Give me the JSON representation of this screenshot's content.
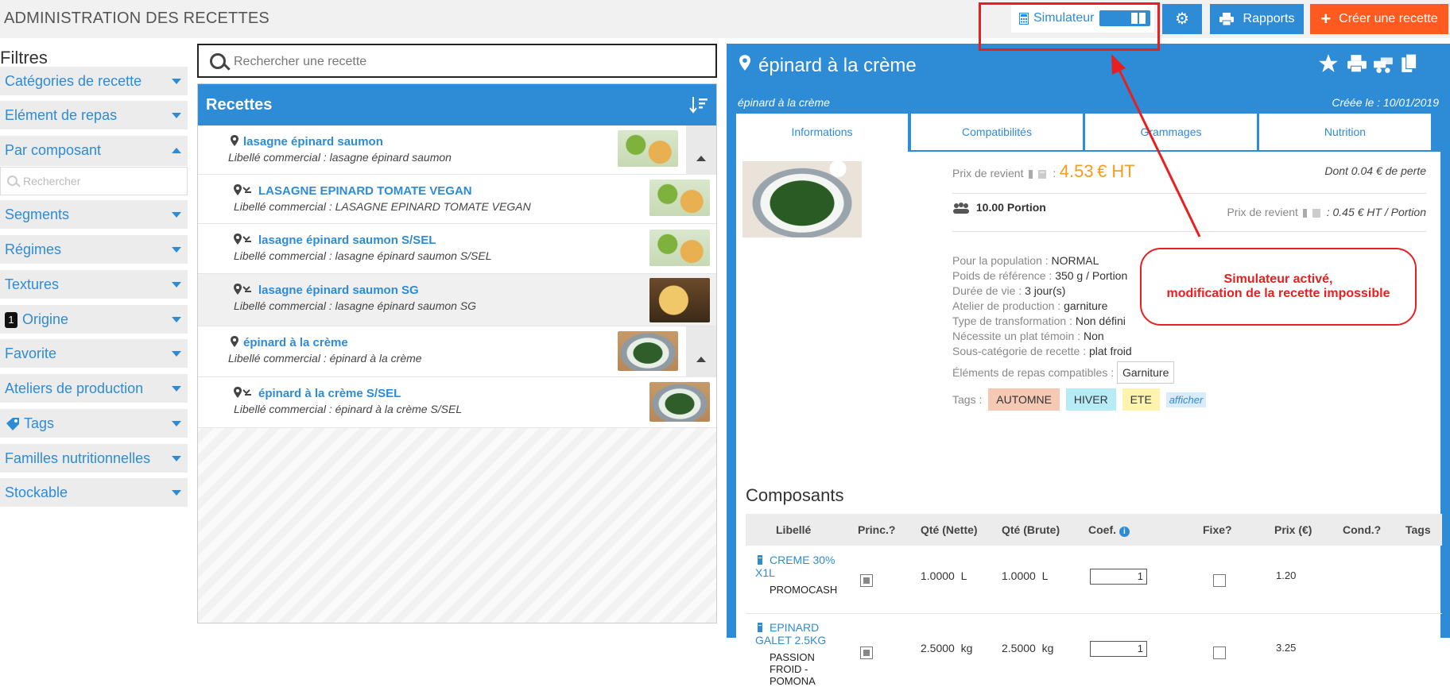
{
  "header": {
    "title": "ADMINISTRATION DES RECETTES",
    "simulator_label": "Simulateur",
    "reports_label": "Rapports",
    "create_label": "Créer une recette"
  },
  "filters": {
    "title": "Filtres",
    "search_placeholder": "Rechercher",
    "origin_badge": "1",
    "items": [
      {
        "label": "Catégories de recette"
      },
      {
        "label": "Elément de repas"
      },
      {
        "label": "Par composant"
      },
      {
        "label": "Segments"
      },
      {
        "label": "Régimes"
      },
      {
        "label": "Textures"
      },
      {
        "label": "Origine"
      },
      {
        "label": "Favorite"
      },
      {
        "label": "Ateliers de production"
      },
      {
        "label": "Tags"
      },
      {
        "label": "Familles nutritionnelles"
      },
      {
        "label": "Stockable"
      }
    ]
  },
  "search": {
    "placeholder": "Rechercher une recette"
  },
  "recipes": {
    "title": "Recettes",
    "items": [
      {
        "title": "lasagne épinard saumon",
        "subtitle": "Libellé commercial : lasagne épinard saumon"
      },
      {
        "title": "LASAGNE EPINARD TOMATE VEGAN",
        "subtitle": "Libellé commercial : LASAGNE EPINARD TOMATE VEGAN"
      },
      {
        "title": "lasagne épinard saumon S/SEL",
        "subtitle": "Libellé commercial : lasagne épinard saumon S/SEL"
      },
      {
        "title": "lasagne épinard saumon SG",
        "subtitle": "Libellé commercial : lasagne épinard saumon SG"
      },
      {
        "title": "épinard à la crème",
        "subtitle": "Libellé commercial : épinard à la crème"
      },
      {
        "title": "épinard à la crème S/SEL",
        "subtitle": "Libellé commercial : épinard à la crème S/SEL"
      }
    ]
  },
  "detail": {
    "title": "épinard à la crème",
    "subtitle": "épinard à la crème",
    "created": "Créée le : 10/01/2019",
    "tabs": [
      "Informations",
      "Compatibilités",
      "Grammages",
      "Nutrition"
    ],
    "cost_label": "Prix de revient",
    "cost_value": "4.53",
    "cost_unit": "€ HT",
    "loss": "Dont 0.04 € de perte",
    "portion": "10.00 Portion",
    "unit_cost_label": "Prix de revient",
    "unit_cost_value": ": 0.45 € HT / Portion",
    "info": [
      {
        "label": "Pour la population :",
        "value": "NORMAL"
      },
      {
        "label": "Poids de référence :",
        "value": "350 g / Portion"
      },
      {
        "label": "Durée de vie :",
        "value": "3 jour(s)"
      },
      {
        "label": "Atelier de production :",
        "value": "garniture"
      },
      {
        "label": "Type de transformation :",
        "value": "Non défini"
      },
      {
        "label": "Nécessite un plat témoin :",
        "value": "Non"
      },
      {
        "label": "Sous-catégorie de recette :",
        "value": "plat froid"
      }
    ],
    "compat_label": "Éléments de repas compatibles :",
    "compat_value": "Garniture",
    "tags_label": "Tags :",
    "tags": [
      {
        "label": "AUTOMNE",
        "color": "#f5c9b3"
      },
      {
        "label": "HIVER",
        "color": "#b7ecf7"
      },
      {
        "label": "ETE",
        "color": "#fff3b0"
      }
    ],
    "tags_more": "afficher"
  },
  "composants": {
    "title": "Composants",
    "columns": [
      "Libellé",
      "Princ.?",
      "Qté (Nette)",
      "Qté (Brute)",
      "Coef.",
      "Fixe?",
      "Prix (€)",
      "Cond.?",
      "Tags"
    ],
    "rows": [
      {
        "name_l1": "CREME 30%",
        "name_l2": "X1L",
        "supplier_l1": "PROMOCASH",
        "supplier_l2": "",
        "supplier_l3": "",
        "princ": true,
        "net": "1.0000",
        "net_unit": "L",
        "gross": "1.0000",
        "gross_unit": "L",
        "coef": "1",
        "fixe": false,
        "price": "1.20"
      },
      {
        "name_l1": "EPINARD",
        "name_l2": "GALET 2.5KG",
        "supplier_l1": "PASSION",
        "supplier_l2": "FROID -",
        "supplier_l3": "POMONA",
        "princ": true,
        "net": "2.5000",
        "net_unit": "kg",
        "gross": "2.5000",
        "gross_unit": "kg",
        "coef": "1",
        "fixe": false,
        "price": "3.25"
      }
    ]
  },
  "annotation": {
    "line1": "Simulateur activé,",
    "line2": "modification de la recette impossible",
    "color": "#e81f1f"
  },
  "colors": {
    "accent": "#2e8bd6",
    "create": "#ff5a1f",
    "price": "#f39c1f"
  }
}
